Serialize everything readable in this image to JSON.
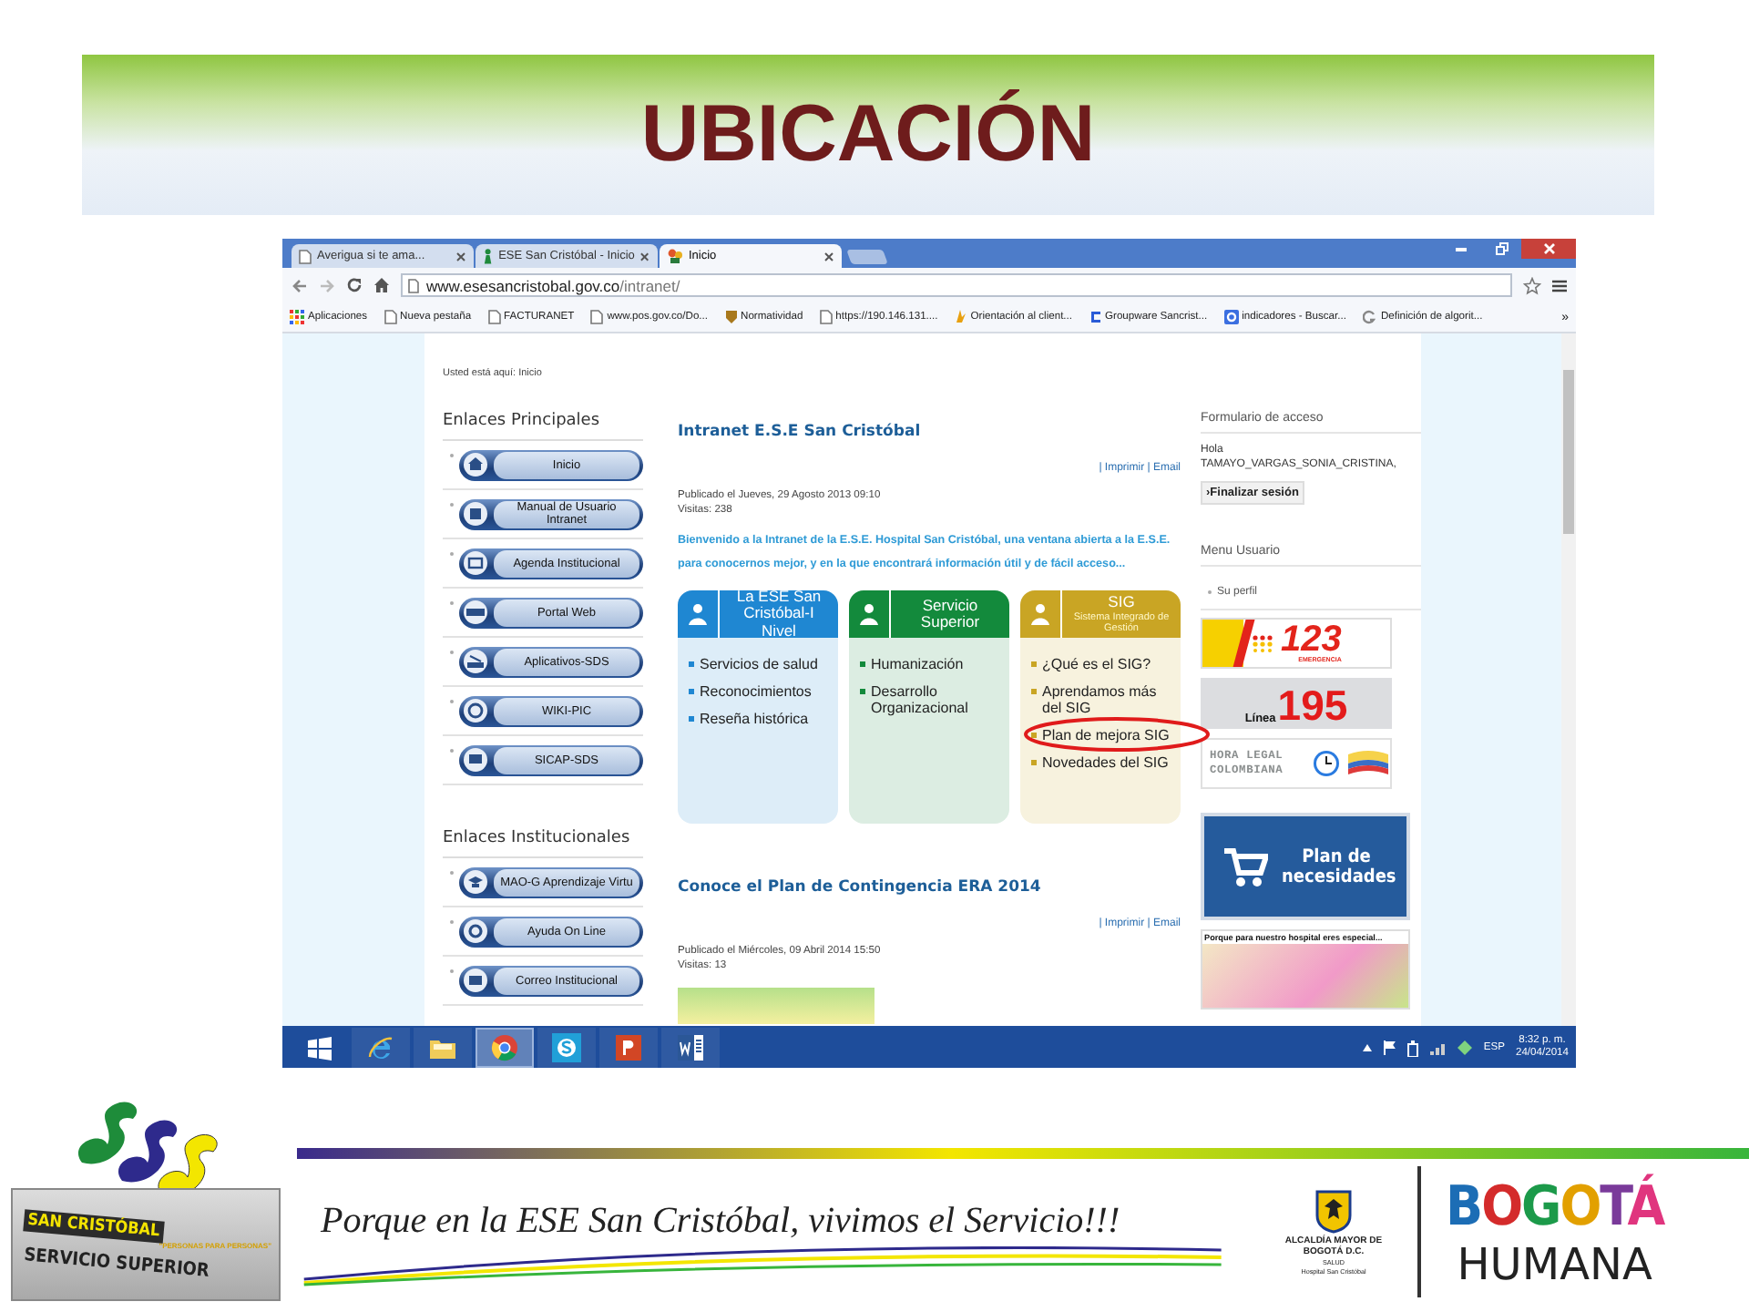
{
  "slide": {
    "title": "UBICACIÓN"
  },
  "browser": {
    "tabs": [
      {
        "label": "Averigua si te ama...",
        "selected": false
      },
      {
        "label": "ESE San Cristóbal - Inicio",
        "selected": false
      },
      {
        "label": "Inicio",
        "selected": true
      }
    ],
    "address": {
      "host": "www.esesancristobal.gov.co",
      "path": "/intranet/"
    },
    "bookmarks": [
      {
        "label": "Aplicaciones",
        "kind": "apps"
      },
      {
        "label": "Nueva pestaña",
        "kind": "page"
      },
      {
        "label": "FACTURANET",
        "kind": "page"
      },
      {
        "label": "www.pos.gov.co/Do...",
        "kind": "page"
      },
      {
        "label": "Normatividad",
        "kind": "crest"
      },
      {
        "label": "https://190.146.131....",
        "kind": "page"
      },
      {
        "label": "Orientación al client...",
        "kind": "mark"
      },
      {
        "label": "Groupware Sancrist...",
        "kind": "groupware"
      },
      {
        "label": "indicadores - Buscar...",
        "kind": "google"
      },
      {
        "label": "Definición de algorit...",
        "kind": "search"
      }
    ],
    "bookmarks_overflow": "»"
  },
  "page": {
    "breadcrumb": "Usted está aquí: Inicio",
    "link_groups": [
      {
        "title": "Enlaces Principales",
        "links": [
          {
            "label": "Inicio",
            "kind": "home"
          },
          {
            "label": "Manual de Usuario Intranet",
            "kind": "book"
          },
          {
            "label": "Agenda Institucional",
            "kind": "agenda"
          },
          {
            "label": "Portal Web",
            "kind": "www"
          },
          {
            "label": "Aplicativos-SDS",
            "kind": "apps"
          },
          {
            "label": "WIKI-PIC",
            "kind": "globe"
          },
          {
            "label": "SICAP-SDS",
            "kind": "monitor"
          }
        ]
      },
      {
        "title": "Enlaces Institucionales",
        "links": [
          {
            "label": "MAO-G Aprendizaje Virtu",
            "kind": "student"
          },
          {
            "label": "Ayuda On Line",
            "kind": "help"
          },
          {
            "label": "Correo Institucional",
            "kind": "mail"
          }
        ]
      }
    ],
    "articles": [
      {
        "title": "Intranet E.S.E San Cristóbal",
        "print": "| Imprimir |",
        "email": "Email",
        "published": "Publicado el Jueves, 29 Agosto 2013 09:10",
        "visits": "Visitas: 238",
        "intro": "Bienvenido a la Intranet de la E.S.E. Hospital San Cristóbal, una ventana abierta a la E.S.E. para conocernos mejor, y en la que encontrará información útil y de fácil acceso...",
        "cards": [
          {
            "title": "La ESE San Cristóbal-I Nivel",
            "color": "#1f87d2",
            "items": [
              {
                "label": "Servicios de salud",
                "circled": false
              },
              {
                "label": "Reconocimientos",
                "circled": false
              },
              {
                "label": "Reseña histórica",
                "circled": false
              }
            ]
          },
          {
            "title": "Servicio Superior",
            "color": "#138a3c",
            "items": [
              {
                "label": "Humanización",
                "circled": false
              },
              {
                "label": "Desarrollo Organizacional",
                "circled": false
              }
            ]
          },
          {
            "title": "SIG",
            "subtitle": "Sistema Integrado de Gestión",
            "color": "#c9a524",
            "items": [
              {
                "label": "¿Qué es el SIG?",
                "circled": false
              },
              {
                "label": "Aprendamos más del SIG",
                "circled": false
              },
              {
                "label": "Plan de mejora SIG",
                "circled": true
              },
              {
                "label": "Novedades del SIG",
                "circled": false
              }
            ]
          }
        ]
      },
      {
        "title": "Conoce el Plan de Contingencia ERA 2014",
        "print": "| Imprimir |",
        "email": "Email",
        "published": "Publicado el Miércoles, 09 Abril 2014 15:50",
        "visits": "Visitas: 13"
      }
    ],
    "login": {
      "title": "Formulario de acceso",
      "greeting": "Hola",
      "user": "TAMAYO_VARGAS_SONIA_CRISTINA,",
      "logout": "›Finalizar sesión"
    },
    "user_menu": {
      "title": "Menu Usuario",
      "items": [
        "Su perfil"
      ]
    },
    "banners": [
      {
        "kind": "emergency",
        "number": "123",
        "caption": "EMERGENCIA"
      },
      {
        "kind": "hotline",
        "label": "Línea",
        "number": "195"
      },
      {
        "kind": "clock",
        "label": "HORA LEGAL COLOMBIANA"
      },
      {
        "kind": "needs",
        "label": "Plan de necesidades"
      },
      {
        "kind": "special",
        "label": "Porque para nuestro hospital eres especial..."
      }
    ]
  },
  "taskbar": {
    "apps": [
      {
        "kind": "explorer",
        "selected": false
      },
      {
        "kind": "files",
        "selected": false
      },
      {
        "kind": "chrome",
        "selected": true
      },
      {
        "kind": "skype",
        "selected": false
      },
      {
        "kind": "powerpoint",
        "selected": false
      },
      {
        "kind": "word",
        "selected": false
      }
    ],
    "language": "ESP",
    "time": "8:32 p. m.",
    "date": "24/04/2014"
  },
  "footer": {
    "logo": {
      "name": "SAN CRISTÓBAL",
      "motto": "\"PERSONAS PARA PERSONAS\"",
      "tagline": "SERVICIO SUPERIOR"
    },
    "slogan": "Porque en la ESE San Cristóbal, vivimos el Servicio!!!",
    "alcaldia": {
      "name": "ALCALDÍA MAYOR DE BOGOTÁ D.C.",
      "sector": "SALUD",
      "entity": "Hospital San Cristóbal"
    },
    "brand": {
      "line1": "BOGOTÁ",
      "line2": "HUMANA"
    }
  }
}
